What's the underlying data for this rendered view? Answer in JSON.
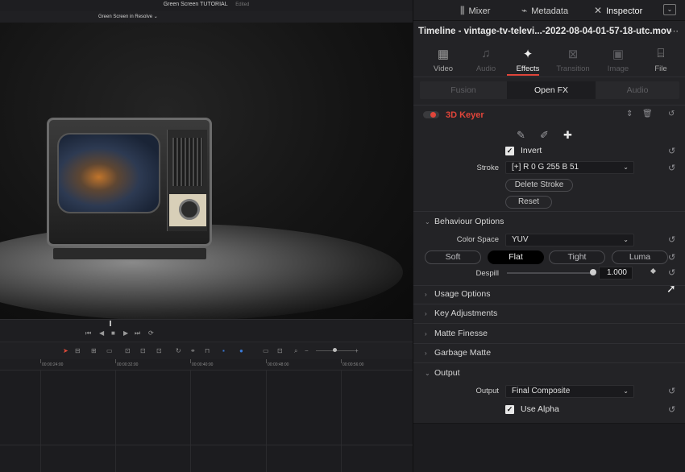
{
  "window": {
    "title": "Green Screen TUTORIAL",
    "status": "Edited",
    "timeline_name": "Green Screen in Resolve",
    "timeline_caret": "⌄"
  },
  "transport": {
    "skip_back": "⏮",
    "step_back": "◀",
    "stop": "■",
    "play": "▶",
    "skip_fwd": "⏭",
    "loop": "⟳"
  },
  "ruler": {
    "timecodes": [
      "00:00:24:00",
      "00:00:32:00",
      "00:00:40:00",
      "00:00:48:00",
      "00:00:56:00"
    ]
  },
  "nav": {
    "mixer": "Mixer",
    "metadata": "Metadata",
    "inspector": "Inspector",
    "collapse_glyph": "⌄"
  },
  "clip": {
    "title": "Timeline - vintage-tv-televi...-2022-08-04-01-57-18-utc.mov",
    "more_glyph": "⋯"
  },
  "tabs": {
    "video": {
      "label": "Video",
      "icon": "video-icon",
      "glyph": "▦"
    },
    "audio": {
      "label": "Audio",
      "icon": "music-note-icon",
      "glyph": "♫"
    },
    "effects": {
      "label": "Effects",
      "icon": "magic-wand-icon",
      "glyph": "✦"
    },
    "transition": {
      "label": "Transition",
      "icon": "transition-icon",
      "glyph": "⊠"
    },
    "image": {
      "label": "Image",
      "icon": "image-icon",
      "glyph": "▣"
    },
    "file": {
      "label": "File",
      "icon": "film-reel-icon",
      "glyph": "⌸"
    }
  },
  "subtabs": {
    "fusion": "Fusion",
    "openfx": "Open FX",
    "audio": "Audio"
  },
  "effect": {
    "name": "3D Keyer",
    "arrows_glyph": "⇕",
    "trash_glyph": "🗑",
    "reset_glyph": "↺",
    "pickers": [
      "✎",
      "✐",
      "✚"
    ],
    "invert_label": "Invert",
    "check_glyph": "✓",
    "stroke_label": "Stroke",
    "stroke_value": "[+]   R 0   G 255   B 51",
    "caret": "⌄",
    "delete_stroke": "Delete Stroke",
    "reset": "Reset"
  },
  "behaviour": {
    "title": "Behaviour Options",
    "expanded_chevron": "⌄",
    "color_space_label": "Color Space",
    "color_space_value": "YUV",
    "modes": [
      "Soft",
      "Flat",
      "Tight",
      "Luma"
    ],
    "active_mode": "Flat",
    "despill_label": "Despill",
    "despill_value": "1.000"
  },
  "sections": {
    "usage": "Usage Options",
    "key_adjustments": "Key Adjustments",
    "matte_finesse": "Matte Finesse",
    "garbage_matte": "Garbage Matte",
    "output": "Output",
    "collapsed_chevron": "›"
  },
  "output": {
    "label": "Output",
    "value": "Final Composite",
    "use_alpha": "Use Alpha"
  },
  "colors": {
    "accent": "#e0453a",
    "panel": "#232326",
    "viewer": "#141414"
  }
}
